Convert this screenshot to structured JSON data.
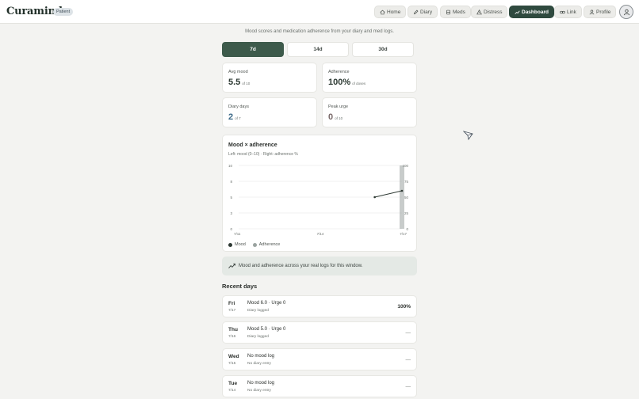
{
  "header": {
    "brand": "Curamind",
    "role_badge": "Patient",
    "nav": [
      {
        "label": "Home",
        "icon": "home-icon"
      },
      {
        "label": "Diary",
        "icon": "pencil-icon"
      },
      {
        "label": "Meds",
        "icon": "pill-icon"
      },
      {
        "label": "Distress",
        "icon": "alert-icon"
      },
      {
        "label": "Dashboard",
        "icon": "trend-icon",
        "active": true
      },
      {
        "label": "Link",
        "icon": "link-icon"
      },
      {
        "label": "Profile",
        "icon": "user-icon"
      }
    ],
    "avatar_icon": "user-icon"
  },
  "subtitle": "Mood scores and medication adherence from your diary and med logs.",
  "ranges": {
    "items": [
      "7d",
      "14d",
      "30d"
    ],
    "selected": "7d"
  },
  "stats": [
    {
      "label": "Avg mood",
      "value": "5.5",
      "unit": "of 10"
    },
    {
      "label": "Adherence",
      "value": "100%",
      "unit": "of doses"
    },
    {
      "label": "Diary days",
      "value": "2",
      "unit": "of 7"
    },
    {
      "label": "Peak urge",
      "value": "0",
      "unit": "of 10"
    }
  ],
  "chart_data": {
    "type": "line",
    "title": "Mood × adherence",
    "subtitle": "Left: mood (0–10) · Right: adherence %",
    "x_ticks": [
      "7/11",
      "7/14",
      "7/17"
    ],
    "y_left_ticks": [
      "10",
      "8",
      "5",
      "3",
      "0"
    ],
    "y_right_ticks": [
      "100",
      "75",
      "50",
      "25",
      "0"
    ],
    "ylim_left": [
      0,
      10
    ],
    "ylim_right": [
      0,
      100
    ],
    "grid": true,
    "legend_position": "bottom-left",
    "series": [
      {
        "name": "Mood",
        "color": "#2f3a34",
        "axis": "left",
        "x": [
          "7/16",
          "7/17"
        ],
        "values": [
          5.0,
          6.0
        ]
      },
      {
        "name": "Adherence",
        "color": "#9aa3a0",
        "axis": "right",
        "type": "bar",
        "x": [
          "7/17"
        ],
        "values": [
          100
        ]
      }
    ]
  },
  "banner": {
    "text": "Mood and adherence across your real logs for this window.",
    "icon": "trend-icon"
  },
  "recent": {
    "title": "Recent days",
    "rows": [
      {
        "day": "Fri",
        "date": "7/17",
        "main": "Mood 6.0 · Urge 0",
        "note": "Diary logged",
        "right": "100%"
      },
      {
        "day": "Thu",
        "date": "7/16",
        "main": "Mood 5.0 · Urge 0",
        "note": "Diary logged",
        "right": "—"
      },
      {
        "day": "Wed",
        "date": "7/15",
        "main": "No mood log",
        "note": "No diary entry",
        "right": "—"
      },
      {
        "day": "Tue",
        "date": "7/14",
        "main": "No mood log",
        "note": "No diary entry",
        "right": "—"
      }
    ]
  }
}
